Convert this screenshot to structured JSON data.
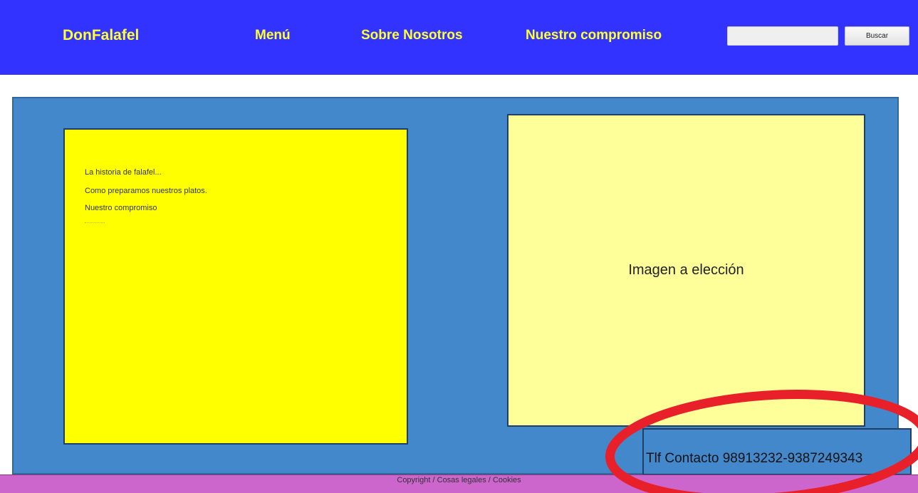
{
  "header": {
    "logo": "DonFalafel",
    "nav": {
      "menu": "Menú",
      "sobre": "Sobre Nosotros",
      "compromiso": "Nuestro compromiso"
    },
    "search": {
      "value": "",
      "button_label": "Buscar"
    }
  },
  "content": {
    "text_lines": [
      "La historia de falafel...",
      "Como preparamos nuestros platos.",
      "Nuestro compromiso"
    ],
    "image_placeholder": "Imagen a elección",
    "contact": "Tlf Contacto 98913232-9387249343"
  },
  "footer": {
    "text": "Copyright / Cosas legales / Cookies"
  },
  "colors": {
    "header_bg": "#3333ff",
    "nav_text": "#ffff33",
    "panel_bg": "#4488cc",
    "text_box_bg": "#ffff00",
    "image_box_bg": "#ffff99",
    "footer_bg": "#cc66cc",
    "annotation": "#e8202a"
  }
}
